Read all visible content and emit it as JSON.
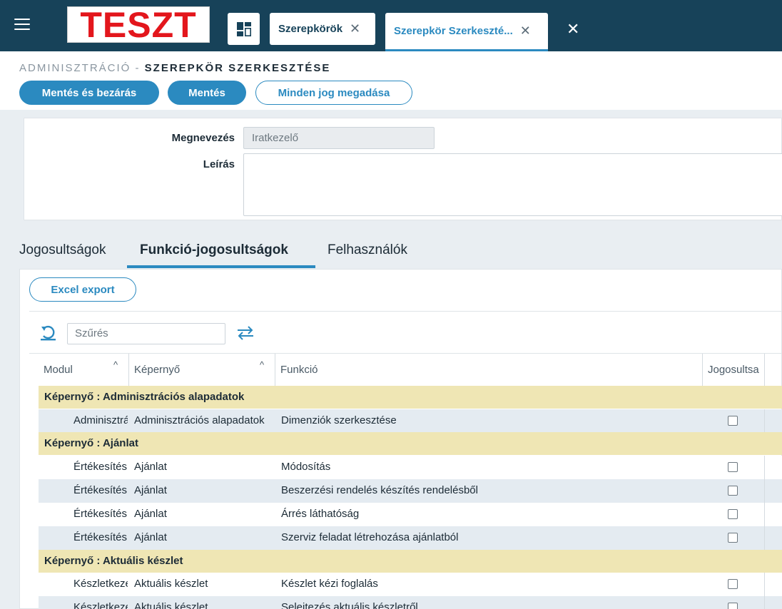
{
  "topbar": {
    "logo_text": "TESZT",
    "tabs": [
      {
        "label": "Szerepkörök"
      },
      {
        "label": "Szerepkör Szerkeszté..."
      }
    ]
  },
  "breadcrumb": {
    "section": "ADMINISZTRÁCIÓ -",
    "page": "SZEREPKÖR SZERKESZTÉSE"
  },
  "actions": {
    "save_close": "Mentés és bezárás",
    "save": "Mentés",
    "grant_all": "Minden jog megadása"
  },
  "form": {
    "name_label": "Megnevezés",
    "name_value": "Iratkezelő",
    "desc_label": "Leírás",
    "desc_value": ""
  },
  "section_tabs": [
    {
      "label": "Jogosultságok"
    },
    {
      "label": "Funkció-jogosultságok"
    },
    {
      "label": "Felhasználók"
    }
  ],
  "grid": {
    "excel_label": "Excel export",
    "filter_placeholder": "Szűrés",
    "columns": [
      "Modul",
      "Képernyő",
      "Funkció",
      "Jogosultsa"
    ],
    "groups": [
      {
        "title": "Képernyő :  Adminisztrációs alapadatok",
        "rows": [
          {
            "modul": "Adminisztrá",
            "kepernyo": "Adminisztrációs alapadatok",
            "funkcio": "Dimenziók szerkesztése",
            "checked": false
          }
        ]
      },
      {
        "title": "Képernyő :  Ajánlat",
        "rows": [
          {
            "modul": "Értékesítés",
            "kepernyo": "Ajánlat",
            "funkcio": "Módosítás",
            "checked": false
          },
          {
            "modul": "Értékesítés",
            "kepernyo": "Ajánlat",
            "funkcio": "Beszerzési rendelés készítés rendelésből",
            "checked": false
          },
          {
            "modul": "Értékesítés",
            "kepernyo": "Ajánlat",
            "funkcio": "Árrés láthatóság",
            "checked": false
          },
          {
            "modul": "Értékesítés",
            "kepernyo": "Ajánlat",
            "funkcio": "Szerviz feladat létrehozása ajánlatból",
            "checked": false
          }
        ]
      },
      {
        "title": "Képernyő :  Aktuális készlet",
        "rows": [
          {
            "modul": "Készletkeze",
            "kepernyo": "Aktuális készlet",
            "funkcio": "Készlet kézi foglalás",
            "checked": false
          },
          {
            "modul": "Készletkeze",
            "kepernyo": "Aktuális készlet",
            "funkcio": "Selejtezés aktuális készletről",
            "checked": false
          }
        ]
      }
    ]
  }
}
